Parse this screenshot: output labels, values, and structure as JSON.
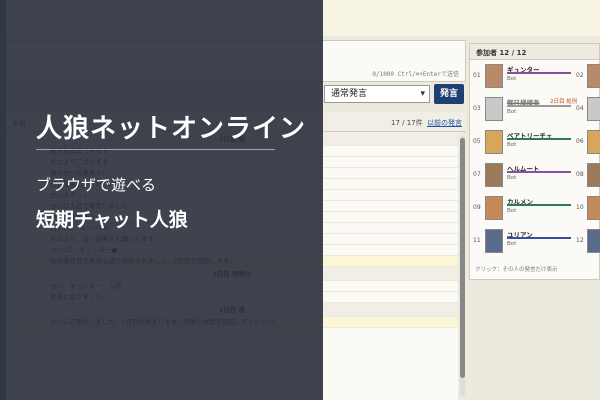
{
  "overlay": {
    "title": "人狼ネットオンライン",
    "subtitle_1": "ブラウザで遊べる",
    "subtitle_2": "短期チャット人狼"
  },
  "composer": {
    "char_count": "0/1000  Ctrl/⌘+Enterで送信",
    "mode": "通常発言",
    "speak_label": "発言"
  },
  "log": {
    "header_left": "全員",
    "count": "17 / 17件",
    "older_link": "以前の発言",
    "rows": [
      {
        "type": "day",
        "text": "2日目 昼"
      },
      {
        "type": "msg",
        "text": "発言を再開できます"
      },
      {
        "type": "msg",
        "text": "おはようございます"
      },
      {
        "type": "msg",
        "text": "誰か占い結果ある？"
      },
      {
        "type": "msg",
        "text": "占い結果出ました"
      },
      {
        "type": "msg",
        "text": "占いよろしく"
      },
      {
        "type": "msg",
        "text": "占いは人狼で確定しました"
      },
      {
        "type": "msg",
        "text": "対抗いますか？"
      },
      {
        "type": "msg",
        "text": "占いCO、ユーリCO"
      },
      {
        "type": "msg",
        "text": "おはよう、占い結果をお願いします"
      },
      {
        "type": "msg",
        "text": "占いCO、ギュンター●"
      },
      {
        "type": "sys",
        "text": "処刑後日食で無残な姿で発見されました。2日目を開始します。"
      },
      {
        "type": "day",
        "text": "1日目 夜明け"
      },
      {
        "type": "msg",
        "text": "占い、ギュンター：人狼"
      },
      {
        "type": "msg",
        "text": "投票になりました。"
      },
      {
        "type": "day",
        "text": "1日目 夜"
      },
      {
        "type": "sys",
        "text": "ゲームを開始しました。1日目が始まります。役職と仲間を確認してください。"
      }
    ]
  },
  "participants": {
    "header": "参加者 12 / 12",
    "hint": "クリック：その人の発言だけ表示",
    "rows": [
      {
        "num": "01",
        "name": "ギュンター",
        "role": "Bot",
        "bar": "#8a4fa0",
        "status": "",
        "dead": false,
        "num2": "02",
        "avatar": "#b98a6a"
      },
      {
        "num": "03",
        "name": "御日様様者",
        "role": "Bot",
        "bar": "#9a9a9a",
        "status": "2日目 処刑",
        "dead": true,
        "num2": "04",
        "avatar": "#c9c9c9"
      },
      {
        "num": "05",
        "name": "ベアトリーチェ",
        "role": "Bot",
        "bar": "#2e7a55",
        "status": "",
        "dead": false,
        "num2": "06",
        "avatar": "#d8a65a"
      },
      {
        "num": "07",
        "name": "ヘルムート",
        "role": "Bot",
        "bar": "#8a4fa0",
        "status": "",
        "dead": false,
        "num2": "08",
        "avatar": "#9a7a5a"
      },
      {
        "num": "09",
        "name": "カルメン",
        "role": "Bot",
        "bar": "#2e7a55",
        "status": "",
        "dead": false,
        "num2": "10",
        "avatar": "#c48a5a"
      },
      {
        "num": "11",
        "name": "ユリアン",
        "role": "Bot",
        "bar": "#3a4f9a",
        "status": "",
        "dead": false,
        "num2": "12",
        "avatar": "#5a6a8a"
      }
    ]
  }
}
